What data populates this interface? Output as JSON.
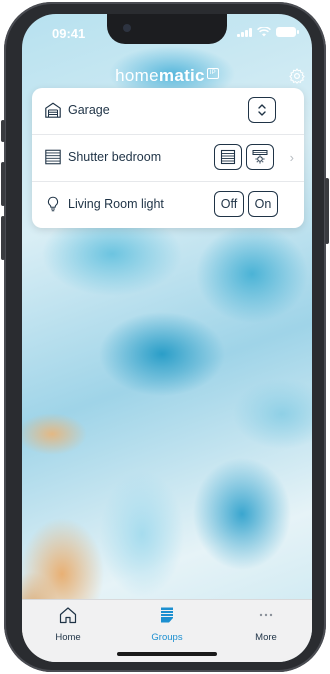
{
  "status": {
    "time": "09:41"
  },
  "header": {
    "brand_light": "home",
    "brand_bold": "matic",
    "brand_mark": "IP"
  },
  "devices": [
    {
      "label": "Garage"
    },
    {
      "label": "Shutter bedroom"
    },
    {
      "label": "Living Room light",
      "off_label": "Off",
      "on_label": "On"
    }
  ],
  "tabbar": {
    "items": [
      {
        "label": "Home"
      },
      {
        "label": "Groups"
      },
      {
        "label": "More"
      }
    ],
    "active": "Groups"
  },
  "colors": {
    "accent": "#1c8fd0",
    "ink": "#1f3346",
    "card": "#ffffff"
  }
}
